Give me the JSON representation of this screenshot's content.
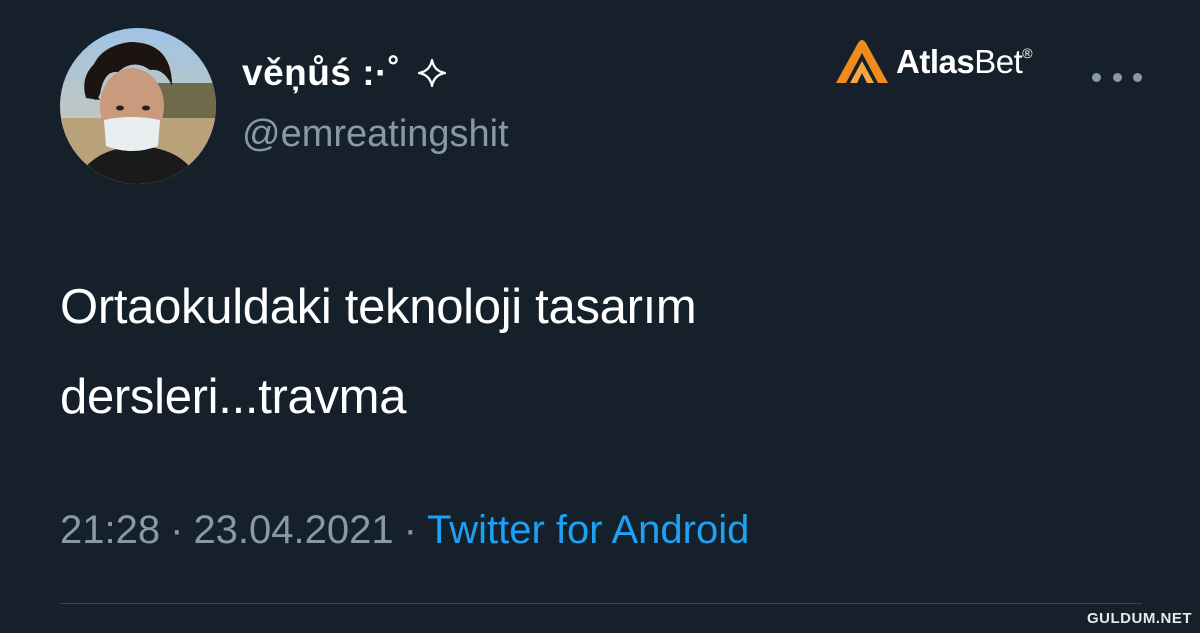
{
  "tweet": {
    "display_name": "věņůś :·˚",
    "name_icon": "sparkle-icon",
    "handle": "@emreatingshit",
    "text_line1": "Ortaokuldaki teknoloji tasarım",
    "text_line2": "dersleri...travma",
    "time": "21:28",
    "date": "23.04.2021",
    "separator": "·",
    "source": "Twitter for Android"
  },
  "ad": {
    "logo_text_bold": "Atlas",
    "logo_text_regular": "Bet",
    "logo_registered": "®",
    "logo_color": "#f08a1c"
  },
  "menu": {
    "icon": "more-horizontal-icon"
  },
  "watermark": {
    "text": "GULDUM.NET"
  },
  "colors": {
    "background": "#15202b",
    "primary_text": "#ffffff",
    "secondary_text": "#8899a6",
    "link": "#1da1f2",
    "divider": "#38444d"
  }
}
